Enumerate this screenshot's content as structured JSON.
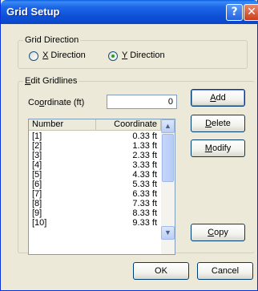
{
  "window": {
    "title": "Grid Setup",
    "help_glyph": "?",
    "close_glyph": "✕"
  },
  "grid_direction": {
    "legend": "Grid Direction",
    "x_prefix": "",
    "x_key": "X",
    "x_suffix": " Direction",
    "y_key": "Y",
    "y_suffix": " Direction",
    "selected": "Y"
  },
  "edit_gridlines": {
    "legend_key": "E",
    "legend_rest": "dit Gridlines",
    "coordinate_label_pre": "Co",
    "coordinate_label_key": "o",
    "coordinate_label_post": "rdinate (ft)",
    "coordinate_value": "0",
    "columns": [
      "Number",
      "Coordinate"
    ],
    "rows": [
      {
        "number": "[1]",
        "coordinate": "0.33 ft"
      },
      {
        "number": "[2]",
        "coordinate": "1.33 ft"
      },
      {
        "number": "[3]",
        "coordinate": "2.33 ft"
      },
      {
        "number": "[4]",
        "coordinate": "3.33 ft"
      },
      {
        "number": "[5]",
        "coordinate": "4.33 ft"
      },
      {
        "number": "[6]",
        "coordinate": "5.33 ft"
      },
      {
        "number": "[7]",
        "coordinate": "6.33 ft"
      },
      {
        "number": "[8]",
        "coordinate": "7.33 ft"
      },
      {
        "number": "[9]",
        "coordinate": "8.33 ft"
      },
      {
        "number": "[10]",
        "coordinate": "9.33 ft"
      }
    ]
  },
  "buttons": {
    "add_key": "A",
    "add_rest": "dd",
    "delete_key": "D",
    "delete_rest": "elete",
    "modify_key": "M",
    "modify_rest": "odify",
    "copy_key": "C",
    "copy_rest": "opy",
    "ok": "OK",
    "cancel": "Cancel"
  },
  "scroll_glyphs": {
    "up": "▲",
    "down": "▼"
  }
}
